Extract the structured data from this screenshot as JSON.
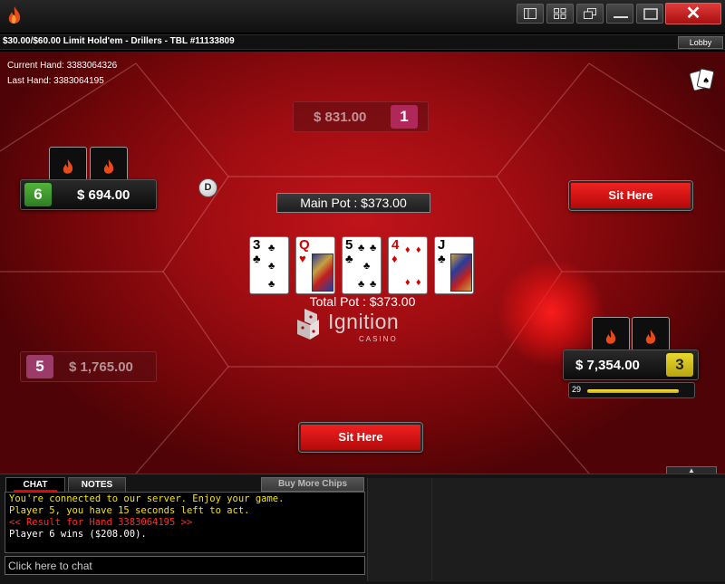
{
  "titlebar": {
    "buttons": [
      {
        "name": "single-table-view-icon"
      },
      {
        "name": "grid-view-icon"
      },
      {
        "name": "cascade-icon"
      },
      {
        "name": "minimize-icon"
      },
      {
        "name": "maximize-icon"
      }
    ],
    "close_label": "✕"
  },
  "infobar": {
    "table_info": "$30.00/$60.00 Limit Hold'em - Drillers - TBL #11133809",
    "lobby_label": "Lobby"
  },
  "hand_info": {
    "current_hand": "Current Hand: 3383064326",
    "last_hand": "Last Hand: 3383064195"
  },
  "seats": [
    {
      "id": 1,
      "number": "1",
      "stack": "$ 831.00",
      "state": "dim",
      "num_color": "#b0285a"
    },
    {
      "id": 3,
      "number": "3",
      "stack": "$ 7,354.00",
      "state": "active",
      "num_color": "#d4c21a",
      "num_text_color": "#222"
    },
    {
      "id": 5,
      "number": "5",
      "stack": "$ 1,765.00",
      "state": "dim",
      "num_color": "#9c3a6a"
    },
    {
      "id": 6,
      "number": "6",
      "stack": "$ 694.00",
      "state": "active",
      "num_color": "#3a9a2a"
    }
  ],
  "sit_here": [
    "Sit Here",
    "Sit Here"
  ],
  "dealer_label": "D",
  "pot": {
    "main": "Main Pot : $373.00",
    "total": "Total Pot : $373.00"
  },
  "board": [
    {
      "rank": "3",
      "suit": "♣",
      "color": "black"
    },
    {
      "rank": "Q",
      "suit": "♥",
      "color": "red"
    },
    {
      "rank": "5",
      "suit": "♣",
      "color": "black"
    },
    {
      "rank": "4",
      "suit": "♦",
      "color": "red"
    },
    {
      "rank": "J",
      "suit": "♣",
      "color": "black"
    }
  ],
  "logo": {
    "word": "Ignition",
    "sub": "CASINO"
  },
  "timer": {
    "seconds": "29",
    "fraction_remaining": 0.83
  },
  "expand_label": "▲",
  "chat": {
    "tab_chat": "CHAT",
    "tab_notes": "NOTES",
    "buy_more_chips": "Buy More Chips",
    "messages": [
      {
        "text": "You're connected to our server. Enjoy your game.",
        "color": "yellow"
      },
      {
        "text": "Player 5, you have 15 seconds left to act.",
        "color": "yellow"
      },
      {
        "text": "<< Result for Hand 3383064195 >>",
        "color": "red"
      },
      {
        "text": "Player 6 wins ($208.00).",
        "color": "white"
      }
    ],
    "input_placeholder": "Click here to chat"
  },
  "colors": {
    "felt": "#a00d12",
    "accent_red": "#e01818",
    "timer_yellow": "#f0d800"
  }
}
